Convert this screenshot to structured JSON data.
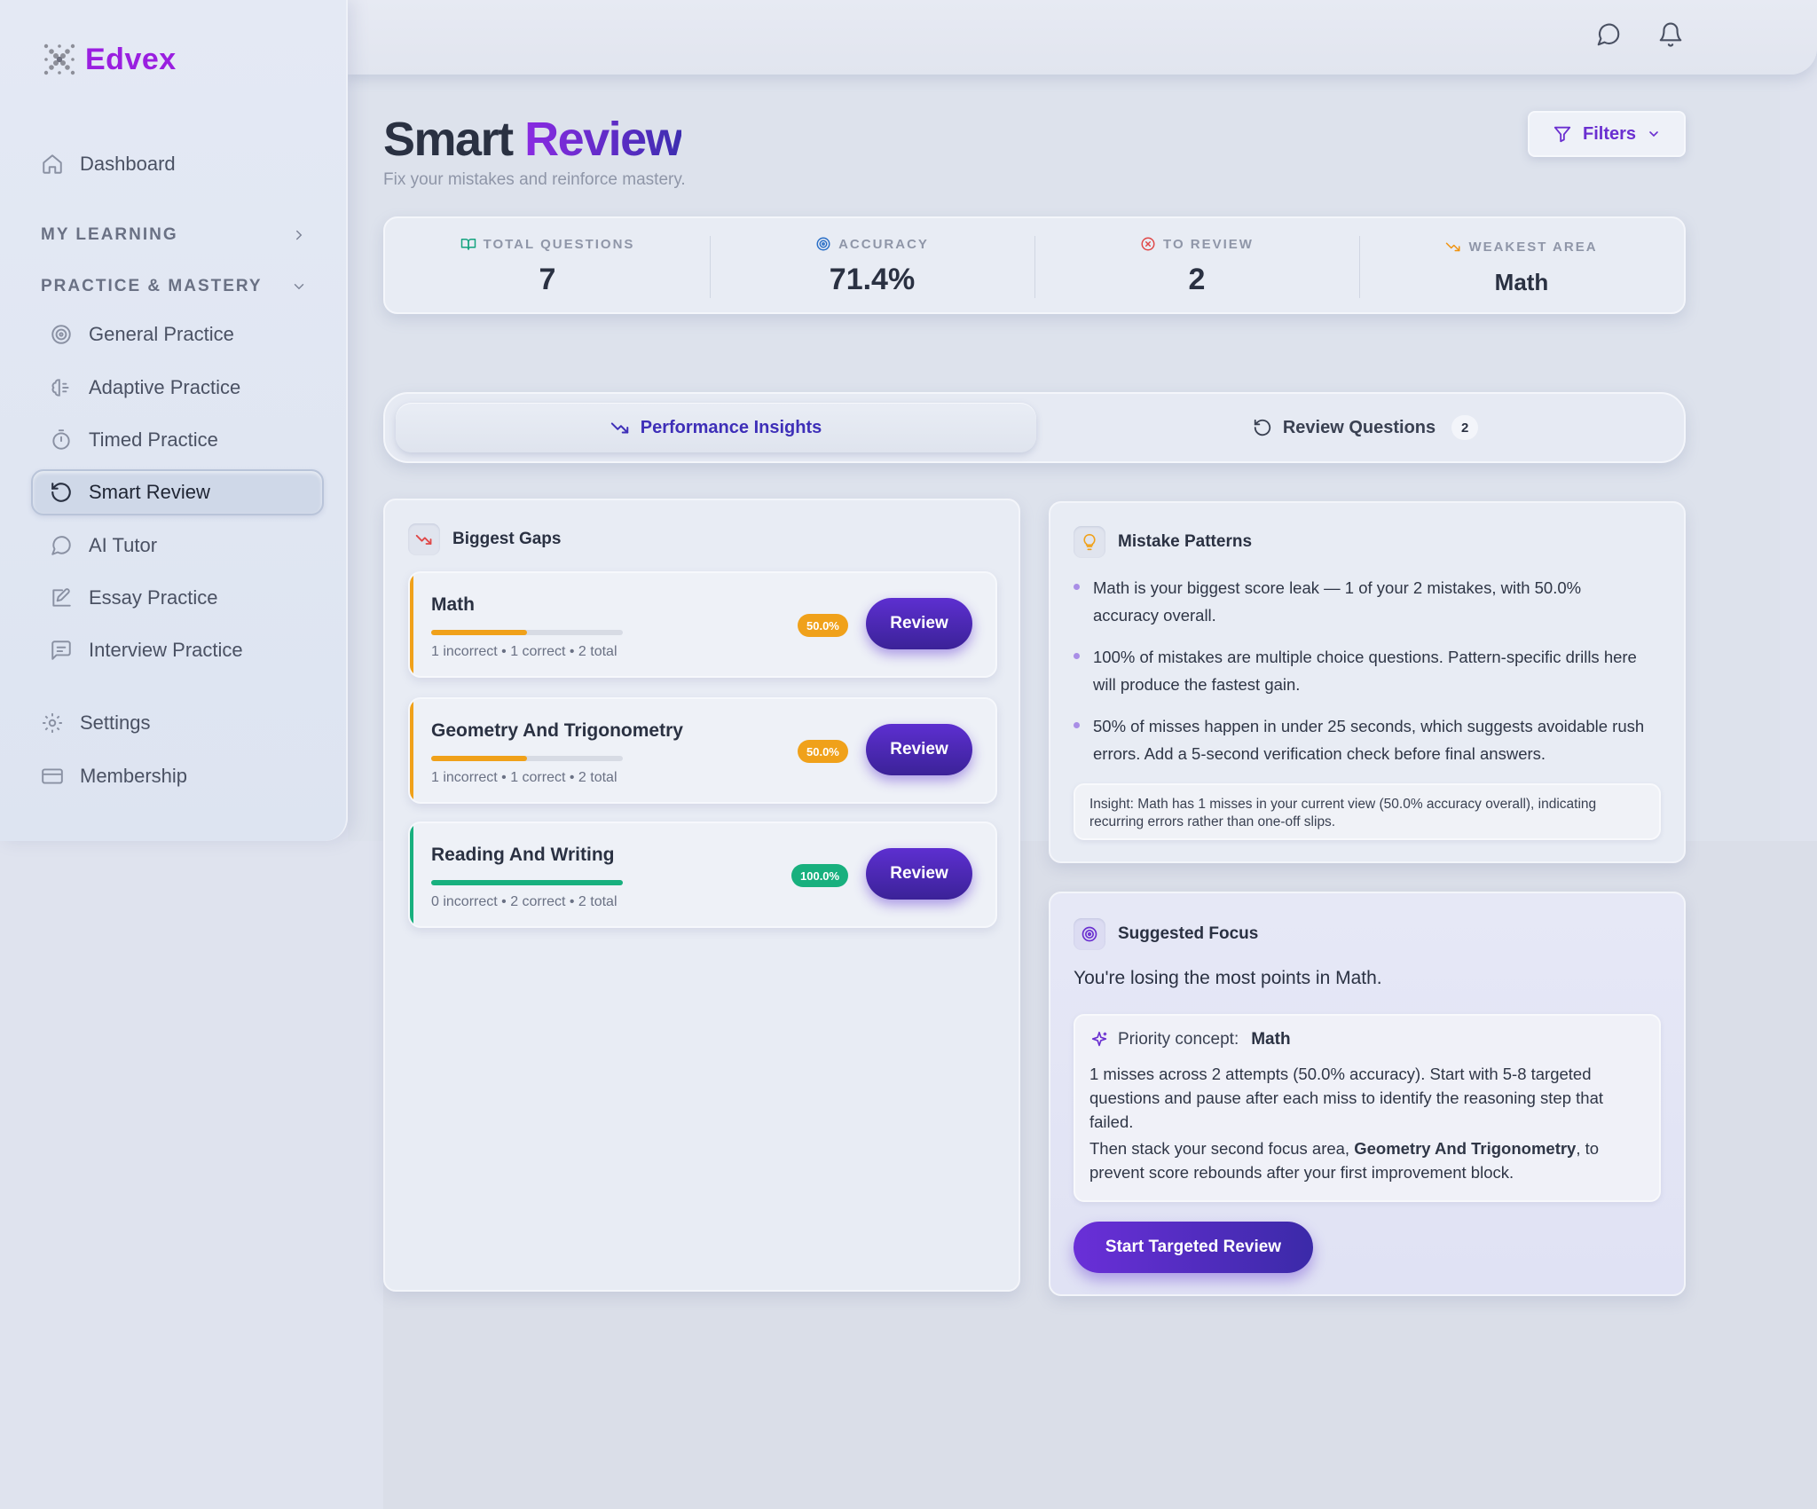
{
  "brand": {
    "name": "Edvex"
  },
  "topbar": {
    "icons": [
      "message-icon",
      "bell-icon"
    ]
  },
  "sidebar": {
    "dashboard": "Dashboard",
    "section_learning": "MY LEARNING",
    "section_practice": "PRACTICE & MASTERY",
    "items": [
      {
        "label": "General Practice",
        "icon": "target-icon"
      },
      {
        "label": "Adaptive Practice",
        "icon": "brain-icon"
      },
      {
        "label": "Timed Practice",
        "icon": "timer-icon"
      },
      {
        "label": "Smart Review",
        "icon": "refresh-icon",
        "active": true
      },
      {
        "label": "AI Tutor",
        "icon": "chat-icon"
      },
      {
        "label": "Essay Practice",
        "icon": "edit-icon"
      },
      {
        "label": "Interview Practice",
        "icon": "message-square-icon"
      }
    ],
    "settings": "Settings",
    "membership": "Membership"
  },
  "header": {
    "title_part1": "Smart ",
    "title_part2": "Review",
    "subtitle": "Fix your mistakes and reinforce mastery.",
    "filters_label": "Filters"
  },
  "stats": [
    {
      "label": "TOTAL QUESTIONS",
      "value": "7",
      "icon": "book-icon",
      "color": "#14a37f"
    },
    {
      "label": "ACCURACY",
      "value": "71.4%",
      "icon": "target-icon",
      "color": "#2a6fc7"
    },
    {
      "label": "TO REVIEW",
      "value": "2",
      "icon": "x-circle-icon",
      "color": "#e04848"
    },
    {
      "label": "WEAKEST AREA",
      "value": "Math",
      "icon": "trend-down-icon",
      "color": "#f0930f"
    }
  ],
  "tabs": {
    "insights": "Performance Insights",
    "review": "Review Questions",
    "review_count": "2"
  },
  "gaps": {
    "title": "Biggest Gaps",
    "items": [
      {
        "name": "Math",
        "meta": "1 incorrect • 1 correct • 2 total",
        "pct": "50.0%",
        "accuracy": 0.5,
        "color": "#f0a11a",
        "button": "Review"
      },
      {
        "name": "Geometry And Trigonometry",
        "meta": "1 incorrect • 1 correct • 2 total",
        "pct": "50.0%",
        "accuracy": 0.5,
        "color": "#f0a11a",
        "button": "Review"
      },
      {
        "name": "Reading And Writing",
        "meta": "0 incorrect • 2 correct • 2 total",
        "pct": "100.0%",
        "accuracy": 1.0,
        "color": "#18b07e",
        "button": "Review"
      }
    ]
  },
  "patterns": {
    "title": "Mistake Patterns",
    "bullets": [
      "Math is your biggest score leak — 1 of your 2 mistakes, with 50.0% accuracy overall.",
      "100% of mistakes are multiple choice questions. Pattern-specific drills here will produce the fastest gain.",
      "50% of misses happen in under 25 seconds, which suggests avoidable rush errors. Add a 5-second verification check before final answers."
    ],
    "insight": "Insight: Math has 1 misses in your current view (50.0% accuracy overall), indicating recurring errors rather than one-off slips."
  },
  "focus": {
    "title": "Suggested Focus",
    "headline": "You're losing the most points in Math.",
    "priority_label": "Priority concept:",
    "priority_value": "Math",
    "text1": "1 misses across 2 attempts (50.0% accuracy). Start with 5-8 targeted questions and pause after each miss to identify the reasoning step that failed.",
    "text2_pre": "Then stack your second focus area, ",
    "text2_bold": "Geometry And Trigonometry",
    "text2_post": ", to prevent score rebounds after your first improvement block.",
    "button": "Start Targeted Review"
  }
}
